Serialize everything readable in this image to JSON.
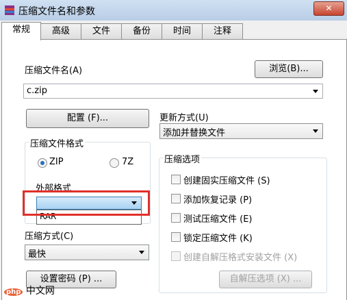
{
  "window": {
    "title": "压缩文件名和参数",
    "close_glyph": "✕"
  },
  "tabs": [
    {
      "label": "常规",
      "active": true
    },
    {
      "label": "高级"
    },
    {
      "label": "文件"
    },
    {
      "label": "备份"
    },
    {
      "label": "时间"
    },
    {
      "label": "注释"
    }
  ],
  "archive": {
    "name_label": "压缩文件名(A)",
    "browse_label": "浏览(B)...",
    "name_value": "c.zip"
  },
  "profile_button_label": "配置 (F)...",
  "update": {
    "label": "更新方式(U)",
    "value": "添加并替换文件"
  },
  "format": {
    "group_title": "压缩文件格式",
    "options": [
      {
        "label": "ZIP",
        "selected": true
      },
      {
        "label": "7Z",
        "selected": false
      }
    ],
    "external_label": "外部格式",
    "external_selected": "",
    "external_list": [
      "RAR"
    ]
  },
  "method": {
    "label": "压缩方式(C)",
    "value": "最快"
  },
  "password_button_label": "设置密码 (P) ...",
  "options": {
    "group_title": "压缩选项",
    "items": [
      {
        "label": "创建固实压缩文件 (S)",
        "enabled": true
      },
      {
        "label": "添加恢复记录 (P)",
        "enabled": true
      },
      {
        "label": "测试压缩文件 (E)",
        "enabled": true
      },
      {
        "label": "锁定压缩文件 (K)",
        "enabled": true
      },
      {
        "label": "创建自解压格式安装文件 (X)",
        "enabled": false
      }
    ],
    "sfx_button_label": "自解压选项 (X) ..."
  },
  "watermark": {
    "badge": "php",
    "text": "中文网"
  },
  "colors": {
    "highlight_box": "#e0302a",
    "radio_selected": "#2a6ec7"
  }
}
